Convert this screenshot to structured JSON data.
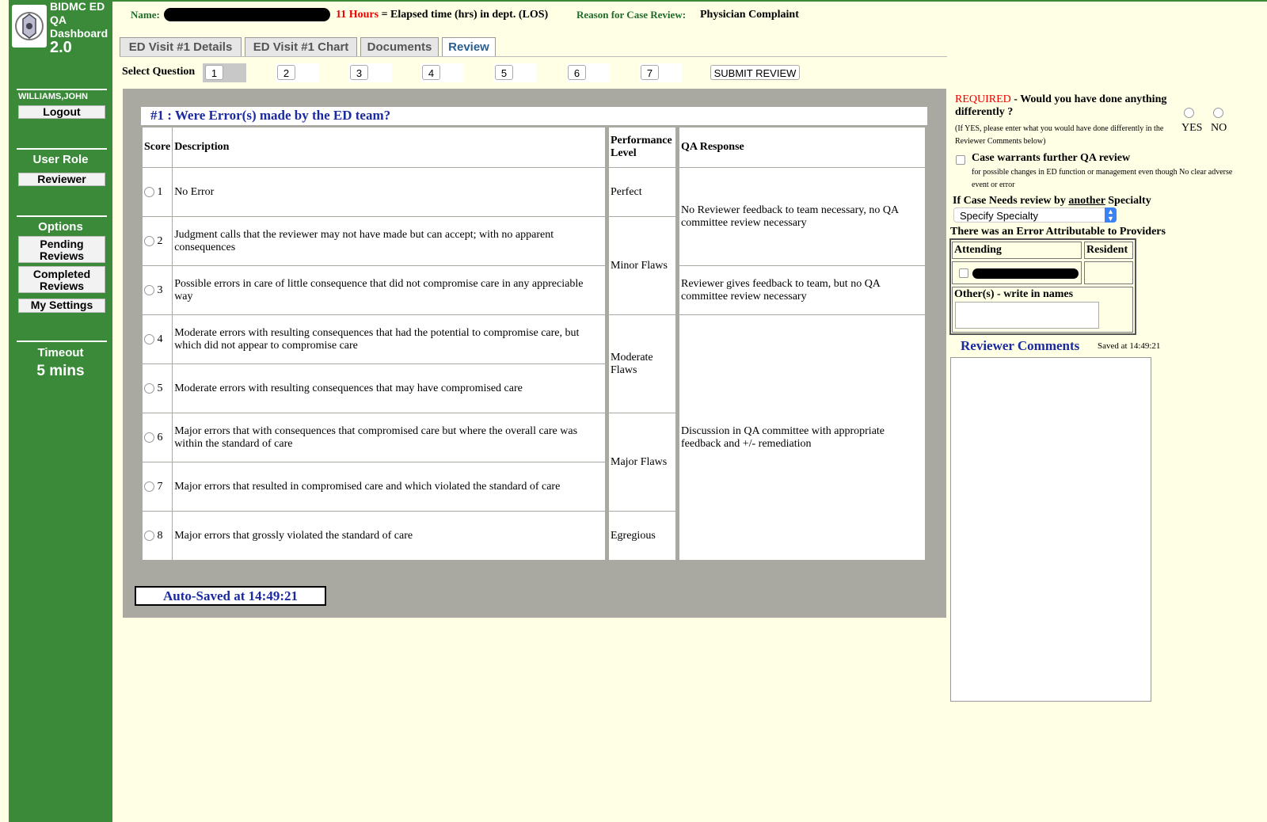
{
  "sidebar": {
    "app_title": "BIDMC ED QA Dashboard",
    "app_version": "2.0",
    "user_name": "WILLIAMS,JOHN",
    "logout_label": "Logout",
    "user_role_heading": "User Role",
    "user_role_value": "Reviewer",
    "options_heading": "Options",
    "pending_label": "Pending Reviews",
    "completed_label": "Completed Reviews",
    "settings_label": "My Settings",
    "timeout_heading": "Timeout",
    "timeout_value": "5 mins"
  },
  "header": {
    "name_label": "Name:",
    "hours_value": "11 Hours",
    "los_text": "= Elapsed time (hrs) in dept. (LOS)",
    "reason_label": "Reason for Case Review:",
    "reason_value": "Physician Complaint"
  },
  "tabs": [
    {
      "label": "ED Visit #1 Details"
    },
    {
      "label": "ED Visit #1 Chart"
    },
    {
      "label": "Documents"
    },
    {
      "label": "Review",
      "active": true
    }
  ],
  "question_selector": {
    "label": "Select Question",
    "questions": [
      "1",
      "2",
      "3",
      "4",
      "5",
      "6",
      "7"
    ],
    "selected": "1",
    "submit_label": "SUBMIT REVIEW"
  },
  "question": {
    "title": "#1 : Were Error(s) made by the ED team?",
    "headers": {
      "score": "Score",
      "description": "Description",
      "performance": "Performance Level",
      "qa_response": "QA Response"
    },
    "rows": [
      {
        "score": "1",
        "description": "No Error"
      },
      {
        "score": "2",
        "description": "Judgment calls that the reviewer may not have made but can accept; with no apparent consequences"
      },
      {
        "score": "3",
        "description": "Possible errors in care of little consequence that did not compromise care in any appreciable way"
      },
      {
        "score": "4",
        "description": "Moderate errors with resulting consequences that had the potential to compromise care, but which did not appear to compromise care"
      },
      {
        "score": "5",
        "description": "Moderate errors with resulting consequences that may have compromised care"
      },
      {
        "score": "6",
        "description": "Major errors that with consequences that compromised care but where the overall care was within the standard of care"
      },
      {
        "score": "7",
        "description": "Major errors that resulted in compromised care and which violated the standard of care"
      },
      {
        "score": "8",
        "description": "Major errors that grossly violated the standard of care"
      }
    ],
    "performance_levels": [
      "Perfect",
      "Minor Flaws",
      "Moderate Flaws",
      "Major Flaws",
      "Egregious"
    ],
    "qa_responses": [
      "No Reviewer feedback to team necessary, no QA committee review necessary",
      "Reviewer gives feedback to team, but no QA committee review necessary",
      "Discussion in QA committee with appropriate feedback and +/- remediation"
    ],
    "autosave_text": "Auto-Saved at 14:49:21"
  },
  "right_panel": {
    "required_label": "REQUIRED",
    "differently_question": "- Would you have done anything differently ?",
    "differently_note": "(If YES, please enter what you would have done differently in the Reviewer Comments below)",
    "yes_label": "YES",
    "no_label": "NO",
    "further_review_label": "Case warrants further QA review",
    "further_review_note": "for possible changes in ED function or management even though No clear adverse event or error",
    "specialty_label_pre": "If Case Needs review by ",
    "specialty_label_u": "another",
    "specialty_label_post": " Specialty",
    "specialty_select": "Specify Specialty",
    "error_attrib_heading": "There was an Error Attributable to Providers",
    "attending_header": "Attending",
    "resident_header": "Resident",
    "others_label": "Other(s) - write in names",
    "comments_title": "Reviewer Comments",
    "comments_saved": "Saved at 14:49:21"
  }
}
